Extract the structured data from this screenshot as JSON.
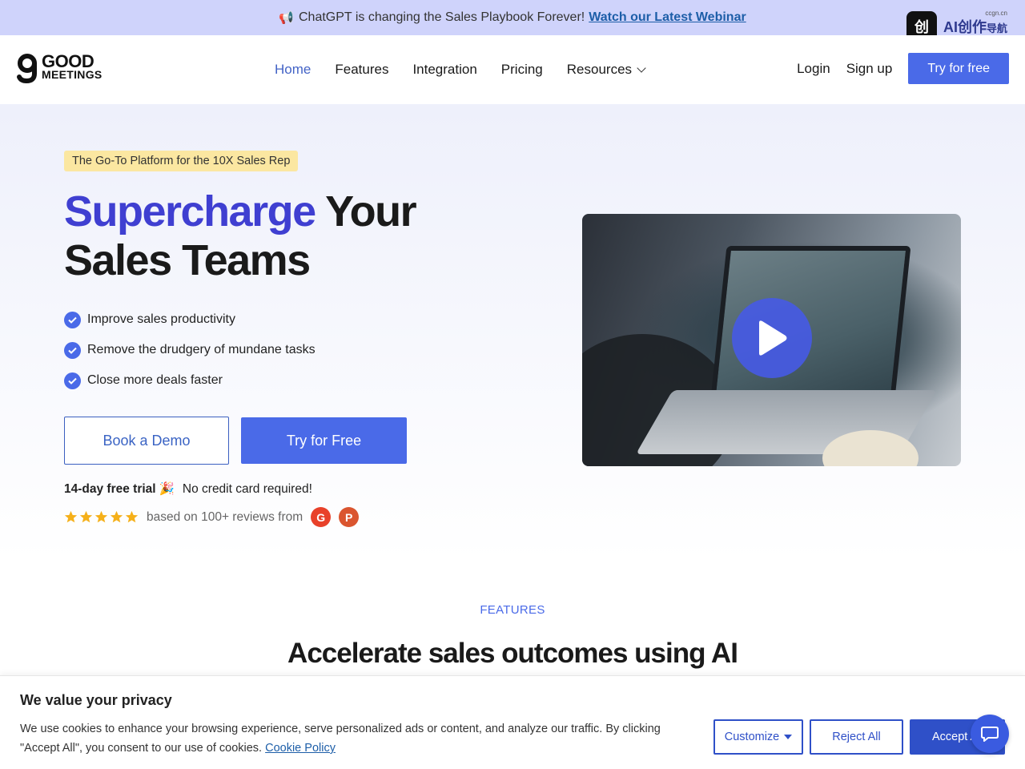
{
  "announcement": {
    "icon": "megaphone-icon",
    "emoji": "📢",
    "text": "ChatGPT is changing the Sales Playbook Forever!",
    "link_text": "Watch our Latest Webinar"
  },
  "ai_badge": {
    "icon_text": "创",
    "title": "AI创作",
    "sub": "导航",
    "domain": "ccgn.cn"
  },
  "nav": {
    "logo_line1": "GOOD",
    "logo_line2": "MEETINGS",
    "items": [
      "Home",
      "Features",
      "Integration",
      "Pricing",
      "Resources"
    ],
    "active": "Home",
    "login": "Login",
    "signup": "Sign up",
    "try_free": "Try for free"
  },
  "hero": {
    "tag": "The Go-To Platform for the 10X Sales Rep",
    "headline_highlight": "Supercharge",
    "headline_rest_1": " Your",
    "headline_line2": "Sales Teams",
    "bullets": [
      "Improve sales productivity",
      "Remove the drudgery of mundane tasks",
      "Close more deals faster"
    ],
    "book_demo": "Book a Demo",
    "try_free": "Try for Free",
    "trial_bold": "14-day free trial",
    "trial_emoji": "🎉",
    "trial_rest": "No credit card required!",
    "rating_stars": 5,
    "reviews_text": "based on 100+ reviews from",
    "review_source_1": "G",
    "review_source_2": "P"
  },
  "features": {
    "label": "FEATURES",
    "title": "Accelerate sales outcomes using AI"
  },
  "cookie": {
    "title": "We value your privacy",
    "text": "We use cookies to enhance your browsing experience, serve personalized ads or content, and analyze our traffic. By clicking \"Accept All\", you consent to our use of cookies.",
    "policy_link": "Cookie Policy",
    "customize": "Customize",
    "reject": "Reject All",
    "accept": "Accept All"
  },
  "colors": {
    "brand_blue": "#4a6ae8",
    "headline_blue": "#3f3fd1",
    "announce_bg": "#cfd3fb",
    "tag_bg": "#fbe7a1"
  }
}
